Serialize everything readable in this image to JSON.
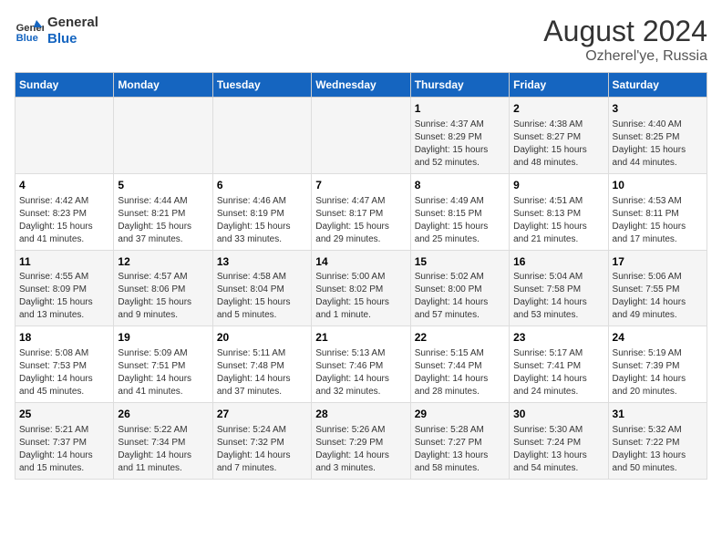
{
  "header": {
    "logo_general": "General",
    "logo_blue": "Blue",
    "month_year": "August 2024",
    "location": "Ozherel'ye, Russia"
  },
  "calendar": {
    "days_of_week": [
      "Sunday",
      "Monday",
      "Tuesday",
      "Wednesday",
      "Thursday",
      "Friday",
      "Saturday"
    ],
    "weeks": [
      [
        {
          "day": "",
          "info": ""
        },
        {
          "day": "",
          "info": ""
        },
        {
          "day": "",
          "info": ""
        },
        {
          "day": "",
          "info": ""
        },
        {
          "day": "1",
          "info": "Sunrise: 4:37 AM\nSunset: 8:29 PM\nDaylight: 15 hours and 52 minutes."
        },
        {
          "day": "2",
          "info": "Sunrise: 4:38 AM\nSunset: 8:27 PM\nDaylight: 15 hours and 48 minutes."
        },
        {
          "day": "3",
          "info": "Sunrise: 4:40 AM\nSunset: 8:25 PM\nDaylight: 15 hours and 44 minutes."
        }
      ],
      [
        {
          "day": "4",
          "info": "Sunrise: 4:42 AM\nSunset: 8:23 PM\nDaylight: 15 hours and 41 minutes."
        },
        {
          "day": "5",
          "info": "Sunrise: 4:44 AM\nSunset: 8:21 PM\nDaylight: 15 hours and 37 minutes."
        },
        {
          "day": "6",
          "info": "Sunrise: 4:46 AM\nSunset: 8:19 PM\nDaylight: 15 hours and 33 minutes."
        },
        {
          "day": "7",
          "info": "Sunrise: 4:47 AM\nSunset: 8:17 PM\nDaylight: 15 hours and 29 minutes."
        },
        {
          "day": "8",
          "info": "Sunrise: 4:49 AM\nSunset: 8:15 PM\nDaylight: 15 hours and 25 minutes."
        },
        {
          "day": "9",
          "info": "Sunrise: 4:51 AM\nSunset: 8:13 PM\nDaylight: 15 hours and 21 minutes."
        },
        {
          "day": "10",
          "info": "Sunrise: 4:53 AM\nSunset: 8:11 PM\nDaylight: 15 hours and 17 minutes."
        }
      ],
      [
        {
          "day": "11",
          "info": "Sunrise: 4:55 AM\nSunset: 8:09 PM\nDaylight: 15 hours and 13 minutes."
        },
        {
          "day": "12",
          "info": "Sunrise: 4:57 AM\nSunset: 8:06 PM\nDaylight: 15 hours and 9 minutes."
        },
        {
          "day": "13",
          "info": "Sunrise: 4:58 AM\nSunset: 8:04 PM\nDaylight: 15 hours and 5 minutes."
        },
        {
          "day": "14",
          "info": "Sunrise: 5:00 AM\nSunset: 8:02 PM\nDaylight: 15 hours and 1 minute."
        },
        {
          "day": "15",
          "info": "Sunrise: 5:02 AM\nSunset: 8:00 PM\nDaylight: 14 hours and 57 minutes."
        },
        {
          "day": "16",
          "info": "Sunrise: 5:04 AM\nSunset: 7:58 PM\nDaylight: 14 hours and 53 minutes."
        },
        {
          "day": "17",
          "info": "Sunrise: 5:06 AM\nSunset: 7:55 PM\nDaylight: 14 hours and 49 minutes."
        }
      ],
      [
        {
          "day": "18",
          "info": "Sunrise: 5:08 AM\nSunset: 7:53 PM\nDaylight: 14 hours and 45 minutes."
        },
        {
          "day": "19",
          "info": "Sunrise: 5:09 AM\nSunset: 7:51 PM\nDaylight: 14 hours and 41 minutes."
        },
        {
          "day": "20",
          "info": "Sunrise: 5:11 AM\nSunset: 7:48 PM\nDaylight: 14 hours and 37 minutes."
        },
        {
          "day": "21",
          "info": "Sunrise: 5:13 AM\nSunset: 7:46 PM\nDaylight: 14 hours and 32 minutes."
        },
        {
          "day": "22",
          "info": "Sunrise: 5:15 AM\nSunset: 7:44 PM\nDaylight: 14 hours and 28 minutes."
        },
        {
          "day": "23",
          "info": "Sunrise: 5:17 AM\nSunset: 7:41 PM\nDaylight: 14 hours and 24 minutes."
        },
        {
          "day": "24",
          "info": "Sunrise: 5:19 AM\nSunset: 7:39 PM\nDaylight: 14 hours and 20 minutes."
        }
      ],
      [
        {
          "day": "25",
          "info": "Sunrise: 5:21 AM\nSunset: 7:37 PM\nDaylight: 14 hours and 15 minutes."
        },
        {
          "day": "26",
          "info": "Sunrise: 5:22 AM\nSunset: 7:34 PM\nDaylight: 14 hours and 11 minutes."
        },
        {
          "day": "27",
          "info": "Sunrise: 5:24 AM\nSunset: 7:32 PM\nDaylight: 14 hours and 7 minutes."
        },
        {
          "day": "28",
          "info": "Sunrise: 5:26 AM\nSunset: 7:29 PM\nDaylight: 14 hours and 3 minutes."
        },
        {
          "day": "29",
          "info": "Sunrise: 5:28 AM\nSunset: 7:27 PM\nDaylight: 13 hours and 58 minutes."
        },
        {
          "day": "30",
          "info": "Sunrise: 5:30 AM\nSunset: 7:24 PM\nDaylight: 13 hours and 54 minutes."
        },
        {
          "day": "31",
          "info": "Sunrise: 5:32 AM\nSunset: 7:22 PM\nDaylight: 13 hours and 50 minutes."
        }
      ]
    ]
  }
}
